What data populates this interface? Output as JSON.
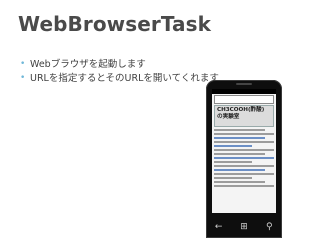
{
  "slide": {
    "title": "WebBrowserTask",
    "bullets": [
      "Webブラウザを起動します",
      "URLを指定するとそのURLを開いてくれます"
    ],
    "accent_color": "#6fb7d8"
  },
  "phone": {
    "hardware_buttons": [
      "back-icon",
      "windows-icon",
      "search-icon"
    ],
    "browser": {
      "page_heading": "CH3COOH(酢酸)",
      "page_subheading": "の実験室"
    }
  }
}
